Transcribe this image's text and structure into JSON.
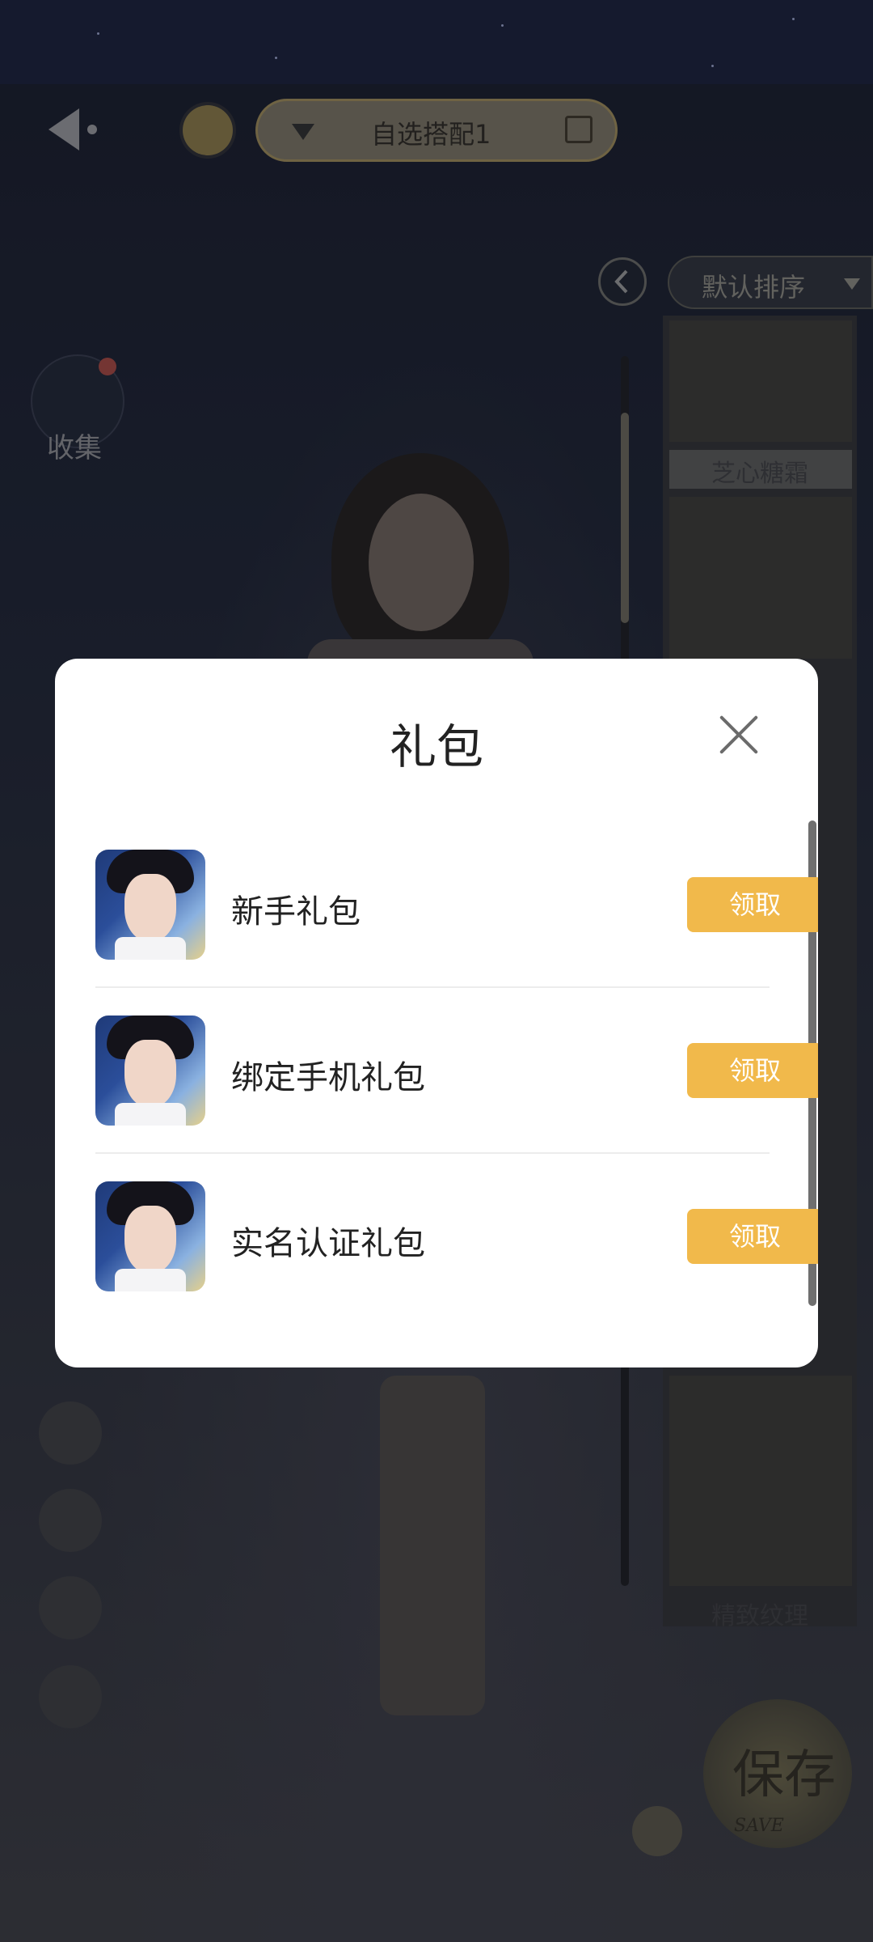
{
  "header": {
    "outfit_name": "自选搭配1",
    "sort_label": "默认排序"
  },
  "sidebar": {
    "collect_label": "收集"
  },
  "right_panel": {
    "card_labels": [
      "芝心糖霜",
      "精致纹理"
    ]
  },
  "save": {
    "label": "保存",
    "sub_label": "SAVE"
  },
  "modal": {
    "title": "礼包",
    "items": [
      {
        "label": "新手礼包",
        "button": "领取"
      },
      {
        "label": "绑定手机礼包",
        "button": "领取"
      },
      {
        "label": "实名认证礼包",
        "button": "领取"
      }
    ]
  },
  "colors": {
    "claim_button": "#f1b94b",
    "modal_bg": "#ffffff",
    "backdrop": "#1c2130"
  }
}
